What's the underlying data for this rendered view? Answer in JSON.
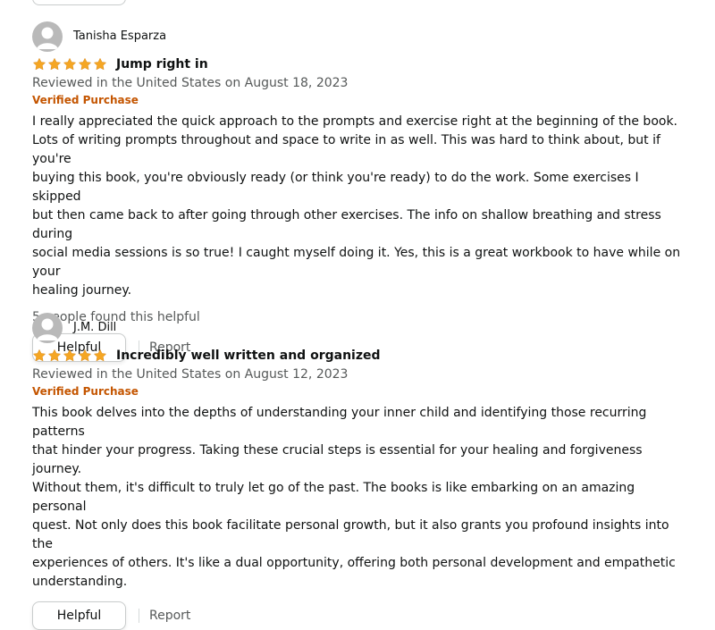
{
  "reviews": [
    {
      "reviewer": "Tanisha Esparza",
      "rating_stars": 5,
      "title": "Jump right in",
      "date": "Reviewed in the United States on August 18, 2023",
      "verified": "Verified Purchase",
      "body": "I really appreciated the quick approach to the prompts and exercise right at the beginning of the book.\nLots of writing prompts throughout and space to write in as well. This was hard to think about, but if you're\nbuying this book, you're obviously ready (or think you're ready) to do the work. Some exercises I skipped\nbut then came back to after going through other exercises. The info on shallow breathing and stress during\nsocial media sessions is so true! I caught myself doing it. Yes, this is a great workbook to have while on your\nhealing journey.",
      "helpful_count": "5 people found this helpful",
      "helpful_button": "Helpful",
      "report_link": "Report"
    },
    {
      "reviewer": "J.M. Dill",
      "rating_stars": 5,
      "title": "Incredibly well written and organized",
      "date": "Reviewed in the United States on August 12, 2023",
      "verified": "Verified Purchase",
      "body": "This book delves into the depths of understanding your inner child and identifying those recurring patterns\nthat hinder your progress. Taking these crucial steps is essential for your healing and forgiveness journey.\nWithout them, it's difficult to truly let go of the past. The books is like embarking on an amazing personal\nquest. Not only does this book facilitate personal growth, but it also grants you profound insights into the\nexperiences of others. It's like a dual opportunity, offering both personal development and empathetic\nunderstanding.",
      "helpful_button": "Helpful",
      "report_link": "Report"
    }
  ],
  "colors": {
    "star": "#f5a623",
    "verified": "#c45500",
    "muted_text": "#565959",
    "button_border": "#c9cccc"
  }
}
